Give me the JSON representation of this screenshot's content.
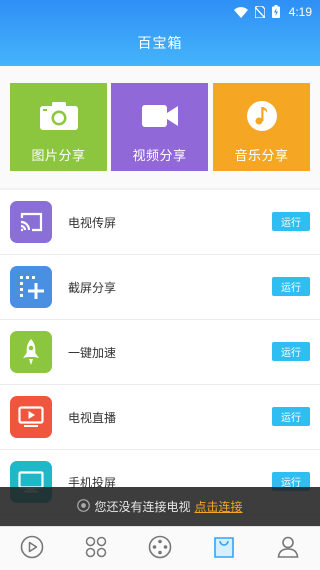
{
  "status_bar": {
    "time": "4:19",
    "icons": [
      "wifi-icon",
      "no-sim-icon",
      "battery-icon"
    ]
  },
  "header": {
    "title": "百宝箱"
  },
  "tiles": [
    {
      "label": "图片分享",
      "icon": "camera-icon",
      "color": "#8cc63e"
    },
    {
      "label": "视频分享",
      "icon": "video-camera-icon",
      "color": "#9068d8"
    },
    {
      "label": "音乐分享",
      "icon": "music-note-icon",
      "color": "#f5a623"
    }
  ],
  "tools": [
    {
      "label": "电视传屏",
      "button": "运行",
      "icon": "cast-icon",
      "color": "#8a6fd6"
    },
    {
      "label": "截屏分享",
      "button": "运行",
      "icon": "screenshot-add-icon",
      "color": "#4a90e2"
    },
    {
      "label": "一键加速",
      "button": "运行",
      "icon": "rocket-icon",
      "color": "#8cc63e"
    },
    {
      "label": "电视直播",
      "button": "运行",
      "icon": "tv-play-icon",
      "color": "#f0553d"
    },
    {
      "label": "手机投屏",
      "button": "运行",
      "icon": "screen-mirror-icon",
      "color": "#1fb8c9"
    }
  ],
  "toast": {
    "message": "您还没有连接电视",
    "link": "点击连接"
  },
  "bottom_nav": [
    {
      "icon": "play-icon",
      "active": false
    },
    {
      "icon": "apps-grid-icon",
      "active": false
    },
    {
      "icon": "film-reel-icon",
      "active": false
    },
    {
      "icon": "toolbox-bag-icon",
      "active": true
    },
    {
      "icon": "user-icon",
      "active": false
    }
  ],
  "colors": {
    "header_top": "#2f8ff5",
    "header_bottom": "#45b4fb",
    "run_button": "#2fbdf2",
    "active_nav": "#2fa6f5",
    "inactive_nav": "#777777",
    "toast_link": "#f6a623"
  }
}
